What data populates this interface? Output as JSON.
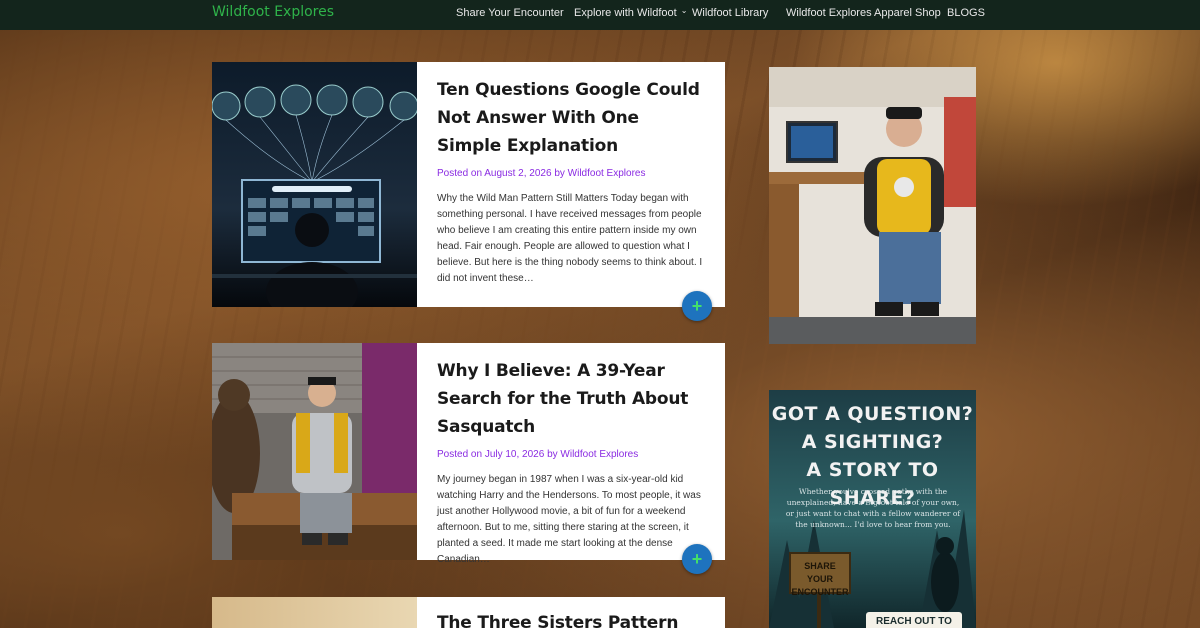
{
  "header": {
    "brand": "Wildfoot Explores",
    "nav": [
      {
        "label": "Share Your Encounter"
      },
      {
        "label": "Explore with Wildfoot"
      },
      {
        "label": "Wildfoot Library"
      },
      {
        "label": "Wildfoot Explores Apparel Shop"
      },
      {
        "label": "BLOGS"
      }
    ]
  },
  "posts": [
    {
      "title": "Ten Questions Google Could Not Answer With One Simple Explanation",
      "meta": "Posted on August 2, 2026 by Wildfoot Explores",
      "excerpt": "Why the Wild Man Pattern Still Matters Today began with something personal. I have received messages from people who believe I am creating this entire pattern inside my own head. Fair enough. People are allowed to question what I believe. But here is the thing nobody seems to think about. I did not invent these…"
    },
    {
      "title": "Why I Believe: A 39-Year Search for the Truth About Sasquatch",
      "meta": "Posted on July 10, 2026 by Wildfoot Explores",
      "excerpt": "My journey began in 1987 when I was a six-year-old kid watching Harry and the Hendersons. To most people, it was just another Hollywood movie, a bit of fun for a weekend afternoon. But to me, sitting there staring at the screen, it planted a seed. It made me start looking at the dense Canadian…"
    },
    {
      "title": "The Three Sisters Pattern"
    }
  ],
  "more_symbol": "+",
  "sidebar": {
    "ad": {
      "headline": [
        "GOT A QUESTION?",
        "A SIGHTING?",
        "A STORY TO SHARE?"
      ],
      "subtext": "Whether you've crossed paths with the unexplained, have a Bigfoot tale of your own, or just want to chat with a fellow wanderer of the unknown... I'd love to hear from you.",
      "sign": "SHARE YOUR ENCOUNTER",
      "cta": "REACH OUT TO"
    }
  }
}
